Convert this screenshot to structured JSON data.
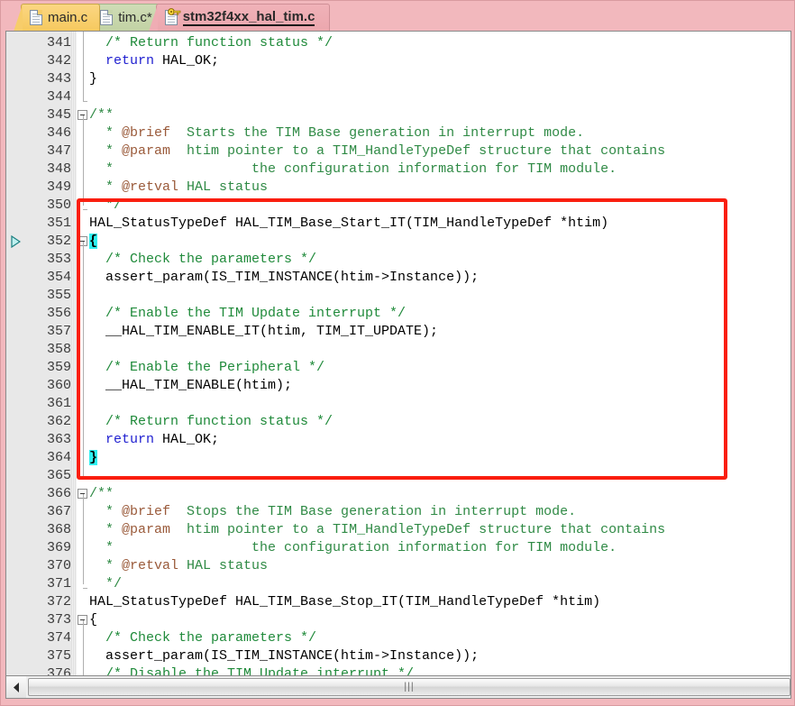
{
  "tabs": [
    {
      "label": "main.c",
      "state": "normal",
      "icon": "document-icon",
      "active": false
    },
    {
      "label": "tim.c*",
      "state": "modified",
      "icon": "document-icon",
      "active": false
    },
    {
      "label": "stm32f4xx_hal_tim.c",
      "state": "readonly",
      "icon": "document-key-icon",
      "active": true
    }
  ],
  "colors": {
    "tab_active_bg": "#f0b2b8",
    "tab_main_bg": "#f7cd6a",
    "tab_tim_bg": "#c8d6ac",
    "frame_bg": "#f2b8bd",
    "comment": "#1f8a3a",
    "keyword": "#1f1fd0",
    "doc_tag": "#9a5a3a",
    "brace_highlight": "#2ff0f0",
    "annotation": "#fa1e0e"
  },
  "editor": {
    "first_visible_line": 341,
    "last_visible_line": 376,
    "brace_match_lines": [
      352,
      364
    ],
    "exec_marker_line": 352,
    "fold_open_lines": [
      345,
      352,
      366,
      373
    ],
    "fold_end_lines": [
      344,
      350,
      371
    ],
    "lines": [
      {
        "n": 341,
        "parts": [
          {
            "t": "  /* Return function status */",
            "c": "cmt"
          }
        ]
      },
      {
        "n": 342,
        "parts": [
          {
            "t": "  ",
            "c": ""
          },
          {
            "t": "return",
            "c": "kw"
          },
          {
            "t": " HAL_OK;",
            "c": ""
          }
        ]
      },
      {
        "n": 343,
        "parts": [
          {
            "t": "}",
            "c": ""
          }
        ]
      },
      {
        "n": 344,
        "parts": []
      },
      {
        "n": 345,
        "parts": [
          {
            "t": "/**",
            "c": "doc"
          }
        ]
      },
      {
        "n": 346,
        "parts": [
          {
            "t": "  * ",
            "c": "doc"
          },
          {
            "t": "@brief",
            "c": "tag"
          },
          {
            "t": "  Starts the TIM Base generation in interrupt mode.",
            "c": "doc"
          }
        ]
      },
      {
        "n": 347,
        "parts": [
          {
            "t": "  * ",
            "c": "doc"
          },
          {
            "t": "@param",
            "c": "tag"
          },
          {
            "t": "  htim pointer to a TIM_HandleTypeDef structure that contains",
            "c": "doc"
          }
        ]
      },
      {
        "n": 348,
        "parts": [
          {
            "t": "  *                 the configuration information for TIM module.",
            "c": "doc"
          }
        ]
      },
      {
        "n": 349,
        "parts": [
          {
            "t": "  * ",
            "c": "doc"
          },
          {
            "t": "@retval",
            "c": "tag"
          },
          {
            "t": " HAL status",
            "c": "doc"
          }
        ]
      },
      {
        "n": 350,
        "parts": [
          {
            "t": "  */",
            "c": "doc"
          }
        ]
      },
      {
        "n": 351,
        "parts": [
          {
            "t": "HAL_StatusTypeDef HAL_TIM_Base_Start_IT(TIM_HandleTypeDef *htim)",
            "c": ""
          }
        ]
      },
      {
        "n": 352,
        "parts": [
          {
            "t": "{",
            "c": "hl"
          }
        ]
      },
      {
        "n": 353,
        "parts": [
          {
            "t": "  /* Check the parameters */",
            "c": "cmt"
          }
        ]
      },
      {
        "n": 354,
        "parts": [
          {
            "t": "  assert_param(IS_TIM_INSTANCE(htim->Instance));",
            "c": ""
          }
        ]
      },
      {
        "n": 355,
        "parts": []
      },
      {
        "n": 356,
        "parts": [
          {
            "t": "  /* Enable the TIM Update interrupt */",
            "c": "cmt"
          }
        ]
      },
      {
        "n": 357,
        "parts": [
          {
            "t": "  __HAL_TIM_ENABLE_IT(htim, TIM_IT_UPDATE);",
            "c": ""
          }
        ]
      },
      {
        "n": 358,
        "parts": []
      },
      {
        "n": 359,
        "parts": [
          {
            "t": "  /* Enable the Peripheral */",
            "c": "cmt"
          }
        ]
      },
      {
        "n": 360,
        "parts": [
          {
            "t": "  __HAL_TIM_ENABLE(htim);",
            "c": ""
          }
        ]
      },
      {
        "n": 361,
        "parts": []
      },
      {
        "n": 362,
        "parts": [
          {
            "t": "  /* Return function status */",
            "c": "cmt"
          }
        ]
      },
      {
        "n": 363,
        "parts": [
          {
            "t": "  ",
            "c": ""
          },
          {
            "t": "return",
            "c": "kw"
          },
          {
            "t": " HAL_OK;",
            "c": ""
          }
        ]
      },
      {
        "n": 364,
        "parts": [
          {
            "t": "}",
            "c": "hl"
          }
        ]
      },
      {
        "n": 365,
        "parts": []
      },
      {
        "n": 366,
        "parts": [
          {
            "t": "/**",
            "c": "doc"
          }
        ]
      },
      {
        "n": 367,
        "parts": [
          {
            "t": "  * ",
            "c": "doc"
          },
          {
            "t": "@brief",
            "c": "tag"
          },
          {
            "t": "  Stops the TIM Base generation in interrupt mode.",
            "c": "doc"
          }
        ]
      },
      {
        "n": 368,
        "parts": [
          {
            "t": "  * ",
            "c": "doc"
          },
          {
            "t": "@param",
            "c": "tag"
          },
          {
            "t": "  htim pointer to a TIM_HandleTypeDef structure that contains",
            "c": "doc"
          }
        ]
      },
      {
        "n": 369,
        "parts": [
          {
            "t": "  *                 the configuration information for TIM module.",
            "c": "doc"
          }
        ]
      },
      {
        "n": 370,
        "parts": [
          {
            "t": "  * ",
            "c": "doc"
          },
          {
            "t": "@retval",
            "c": "tag"
          },
          {
            "t": " HAL status",
            "c": "doc"
          }
        ]
      },
      {
        "n": 371,
        "parts": [
          {
            "t": "  */",
            "c": "doc"
          }
        ]
      },
      {
        "n": 372,
        "parts": [
          {
            "t": "HAL_StatusTypeDef HAL_TIM_Base_Stop_IT(TIM_HandleTypeDef *htim)",
            "c": ""
          }
        ]
      },
      {
        "n": 373,
        "parts": [
          {
            "t": "{",
            "c": ""
          }
        ]
      },
      {
        "n": 374,
        "parts": [
          {
            "t": "  /* Check the parameters */",
            "c": "cmt"
          }
        ]
      },
      {
        "n": 375,
        "parts": [
          {
            "t": "  assert_param(IS_TIM_INSTANCE(htim->Instance));",
            "c": ""
          }
        ]
      },
      {
        "n": 376,
        "parts": [
          {
            "t": "  /* Disable the TIM Update interrupt */",
            "c": "cmt"
          }
        ]
      }
    ]
  },
  "annotation": {
    "shape": "rectangle",
    "color": "#fa1e0e",
    "covers_lines": [
      350,
      365
    ]
  },
  "scrollbar": {
    "orientation": "horizontal",
    "left_arrow": "◄",
    "grip": "|||"
  }
}
